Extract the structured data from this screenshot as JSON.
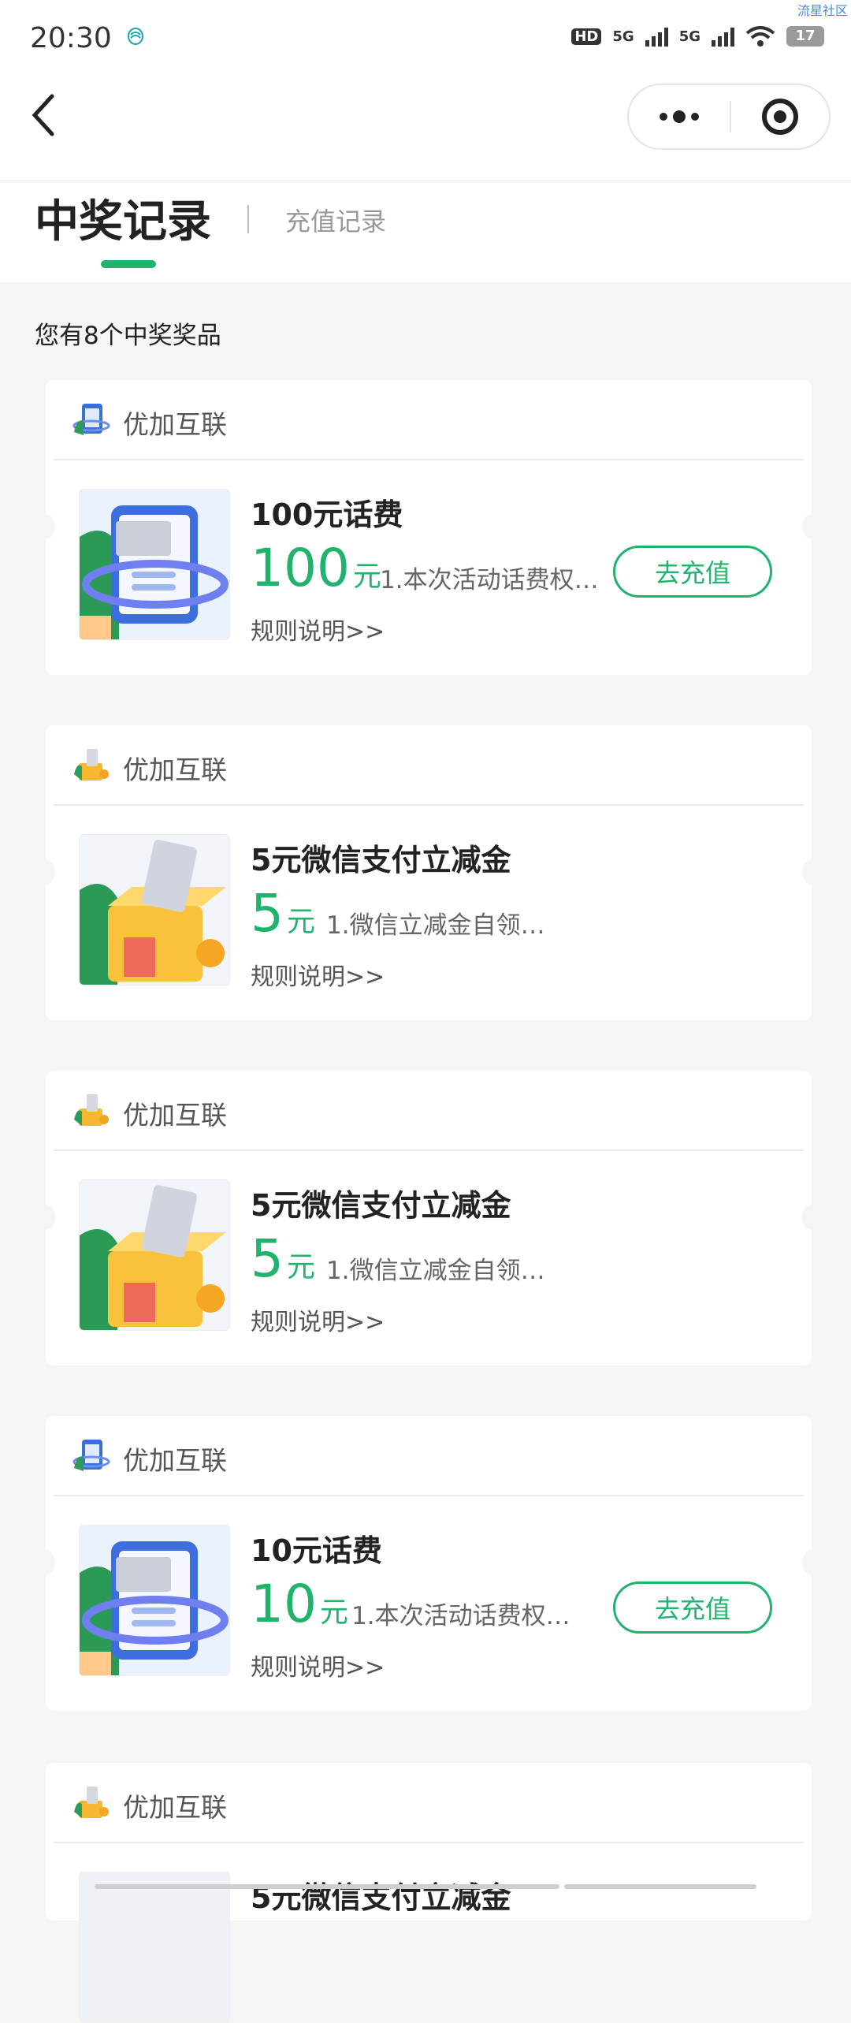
{
  "status_bar": {
    "time": "20:30",
    "hd": "HD",
    "sim1_label": "5G",
    "sim2_label": "5G",
    "battery": "17",
    "watermark": "流星社区"
  },
  "nav": {
    "back_icon": "chevron-left-icon",
    "more_icon": "more-dots-icon",
    "target_icon": "target-circle-icon"
  },
  "tabs": {
    "active": "中奖记录",
    "inactive": "充值记录"
  },
  "summary": "您有8个中奖奖品",
  "colors": {
    "accent": "#1fb36b",
    "background": "#f5f5f5",
    "card": "#ffffff"
  },
  "cards": [
    {
      "shop": "优加互联",
      "logo": "phone-doc-icon",
      "thumb": "phone-card-illustration",
      "title": "100元话费",
      "amount": "100",
      "unit": "元",
      "desc": "1.本次活动话费权…",
      "rule": "规则说明>>",
      "button": "去充值"
    },
    {
      "shop": "优加互联",
      "logo": "piggy-box-icon",
      "thumb": "money-box-illustration",
      "title": "5元微信支付立减金",
      "amount": "5",
      "unit": "元",
      "desc": "1.微信立减金自领…",
      "rule": "规则说明>>"
    },
    {
      "shop": "优加互联",
      "logo": "piggy-box-icon",
      "thumb": "money-box-illustration",
      "title": "5元微信支付立减金",
      "amount": "5",
      "unit": "元",
      "desc": "1.微信立减金自领…",
      "rule": "规则说明>>"
    },
    {
      "shop": "优加互联",
      "logo": "phone-doc-icon",
      "thumb": "phone-card-illustration",
      "title": "10元话费",
      "amount": "10",
      "unit": "元",
      "desc": "1.本次活动话费权…",
      "rule": "规则说明>>",
      "button": "去充值"
    },
    {
      "shop": "优加互联",
      "logo": "piggy-box-icon",
      "thumb": "money-box-illustration",
      "title": "5元微信支付立减金"
    }
  ]
}
